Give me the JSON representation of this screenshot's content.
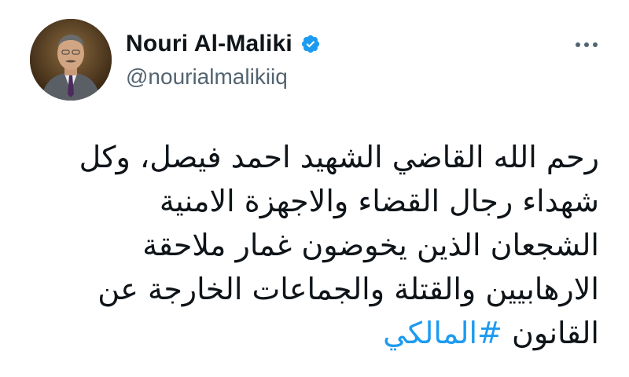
{
  "author": {
    "display_name": "Nouri Al-Maliki",
    "handle": "@nourialmalikiiq",
    "verified": true
  },
  "colors": {
    "text": "#0f1419",
    "secondary": "#536471",
    "accent": "#1d9bf0"
  },
  "icons": {
    "verified": "verified-badge-icon",
    "more": "more-options-icon"
  },
  "tweet": {
    "lines": [
      "رحم الله القاضي الشهيد احمد فيصل، وكل",
      "شهداء رجال القضاء والاجهزة الامنية",
      "الشجعان الذين يخوضون غمار ملاحقة",
      "الارهابيين والقتلة والجماعات الخارجة عن"
    ],
    "last_line_text": "القانون",
    "hashtag": "#المالكي"
  }
}
